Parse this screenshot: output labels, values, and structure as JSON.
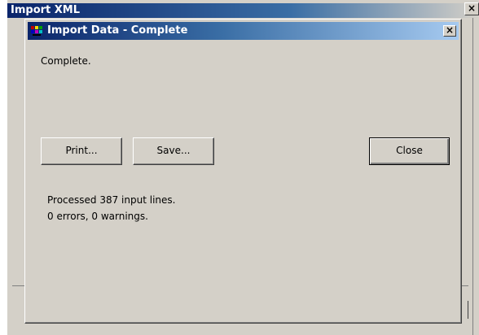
{
  "background_window": {
    "title": "Import XML",
    "close_glyph": "×"
  },
  "dialog": {
    "title": "Import Data - Complete",
    "close_glyph": "×",
    "status": "Complete.",
    "buttons": {
      "print": "Print...",
      "save": "Save...",
      "close": "Close"
    },
    "results": {
      "lines": "Processed 387 input lines.",
      "errors": "0 errors, 0 warnings."
    }
  },
  "colors": {
    "titlebar_start": "#0a246a",
    "titlebar_end": "#a6caf0",
    "face": "#d4d0c8"
  }
}
